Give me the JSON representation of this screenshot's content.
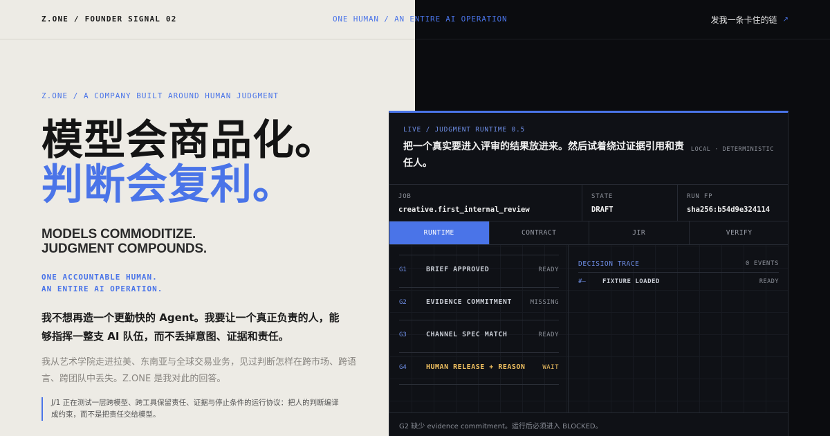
{
  "header": {
    "brand": "Z.ONE / FOUNDER SIGNAL 02",
    "tagline": "ONE HUMAN / AN ENTIRE AI OPERATION",
    "link_label": "发我一条卡住的链",
    "link_icon": "arrow-up-right-icon"
  },
  "hero": {
    "eyebrow": "Z.ONE / A COMPANY BUILT AROUND HUMAN JUDGMENT",
    "title_line1": "模型会商品化。",
    "title_line2": "判断会复利。",
    "en_line1": "MODELS COMMODITIZE.",
    "en_line2": "JUDGMENT COMPOUNDS.",
    "sub_line1": "ONE ACCOUNTABLE HUMAN.",
    "sub_line2": "AN ENTIRE AI OPERATION.",
    "para1": "我不想再造一个更勤快的 Agent。我要让一个真正负责的人，能够指挥一整支 AI 队伍，而不丢掉意图、证据和责任。",
    "para2": "我从艺术学院走进拉美、东南亚与全球交易业务，见过判断怎样在跨市场、跨语言、跨团队中丢失。Z.ONE 是我对此的回答。",
    "quote": "J/1 正在测试一层跨模型、跨工具保留责任、证据与停止条件的运行协议：把人的判断编译成约束，而不是把责任交给模型。"
  },
  "panel": {
    "live_label": "LIVE / JUDGMENT RUNTIME 0.5",
    "title": "把一个真实要进入评审的结果放进来。然后试着绕过证据引用和责任人。",
    "mode": "LOCAL · DETERMINISTIC",
    "meta": [
      {
        "label": "JOB",
        "value": "creative.first_internal_review"
      },
      {
        "label": "STATE",
        "value": "DRAFT"
      },
      {
        "label": "RUN FP",
        "value": "sha256:b54d9e324114"
      }
    ],
    "tabs": [
      "RUNTIME",
      "CONTRACT",
      "JIR",
      "VERIFY"
    ],
    "active_tab": "RUNTIME",
    "gates": [
      {
        "id": "G1",
        "name": "BRIEF APPROVED",
        "status": "READY"
      },
      {
        "id": "G2",
        "name": "EVIDENCE COMMITMENT",
        "status": "MISSING"
      },
      {
        "id": "G3",
        "name": "CHANNEL SPEC MATCH",
        "status": "READY"
      },
      {
        "id": "G4",
        "name": "HUMAN RELEASE + REASON",
        "status": "WAIT"
      }
    ],
    "trace": {
      "title": "DECISION TRACE",
      "count": "0 EVENTS",
      "rows": [
        {
          "mark": "#—",
          "name": "FIXTURE LOADED",
          "status": "READY"
        }
      ]
    },
    "footer": "G2 缺少 evidence commitment。运行后必须进入 BLOCKED。"
  },
  "colors": {
    "accent": "#4a74e8",
    "warn": "#f0c060",
    "left_bg": "#edebe5",
    "right_bg": "#0b0c0f"
  }
}
